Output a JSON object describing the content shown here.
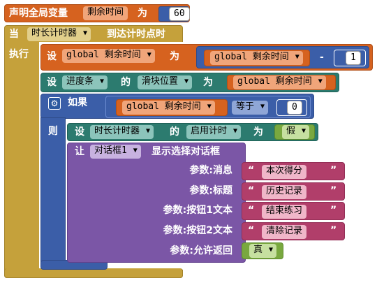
{
  "global_decl": {
    "label": "声明全局变量",
    "var_name": "剩余时间",
    "to": "为",
    "value": "60"
  },
  "event": {
    "when": "当",
    "component": "时长计时器",
    "event_name": "到达计时点时",
    "do": "执行"
  },
  "set_global": {
    "set": "设",
    "var": "global 剩余时间",
    "to": "为",
    "get_var": "global 剩余时间",
    "op": "-",
    "num": "1"
  },
  "set_slider": {
    "set": "设",
    "component": "进度条",
    "of": "的",
    "property": "滑块位置",
    "to": "为",
    "get_var": "global 剩余时间"
  },
  "if_block": {
    "if": "如果",
    "get_var": "global 剩余时间",
    "compare": "等于",
    "num": "0",
    "then": "则"
  },
  "set_timer": {
    "set": "设",
    "component": "时长计时器",
    "of": "的",
    "property": "启用计时",
    "to": "为",
    "value": "假"
  },
  "dialog": {
    "call": "让",
    "component": "对话框1",
    "method": "显示选择对话框",
    "params": [
      {
        "label": "参数:消息",
        "value": "本次得分"
      },
      {
        "label": "参数:标题",
        "value": "历史记录"
      },
      {
        "label": "参数:按钮1文本",
        "value": "结束练习"
      },
      {
        "label": "参数:按钮2文本",
        "value": "清除记录"
      }
    ],
    "cancel_label": "参数:允许返回",
    "cancel_value": "真"
  },
  "icons": [
    "dropdown-caret-icon",
    "gear-icon"
  ],
  "colors": {
    "variable": "#d6621f",
    "event": "#c5a13b",
    "component_set": "#2c7b6f",
    "control": "#3b5ea8",
    "component_call": "#7b56a6",
    "text": "#b13e6a",
    "logic": "#79a83f"
  }
}
